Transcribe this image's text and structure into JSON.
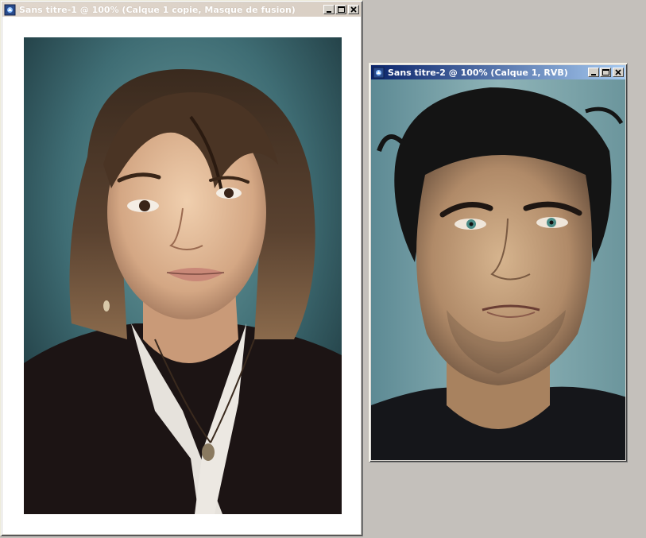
{
  "windows": [
    {
      "title": "Sans titre-1 @ 100% (Calque 1 copie, Masque de fusion)",
      "state": "inactive",
      "image": "portrait-young-woman"
    },
    {
      "title": "Sans titre-2 @ 100% (Calque 1, RVB)",
      "state": "active",
      "image": "portrait-man"
    }
  ],
  "icons": {
    "app": "photoshop-document-icon",
    "minimize": "minimize-icon",
    "maximize": "maximize-icon",
    "close": "close-icon"
  },
  "colors": {
    "workspace": "#c4c0bb",
    "active_title_start": "#0a246a",
    "active_title_end": "#a6caf0",
    "inactive_title": "#e0d6cc",
    "photo_background_teal": "#3f6d74"
  }
}
